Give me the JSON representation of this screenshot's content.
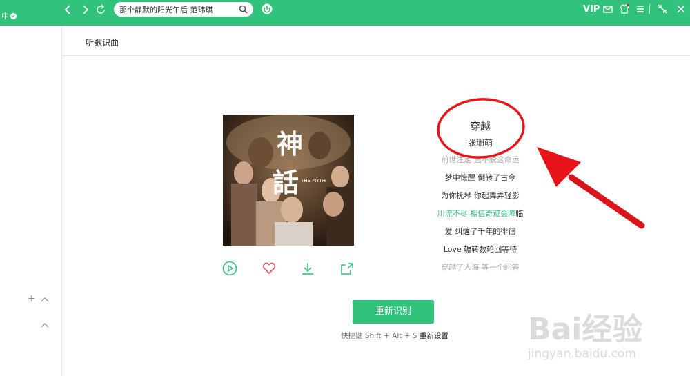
{
  "topbar": {
    "left_fragment": "中",
    "search": {
      "value": "那个静默的阳光午后 范玮琪",
      "placeholder": ""
    },
    "vip_label": "VIP"
  },
  "header": {
    "title": "听歌识曲"
  },
  "song": {
    "title": "穿越",
    "artist": "张珊萌",
    "lyrics": [
      {
        "text": "前世注定 逃不脱这命运",
        "state": "faded"
      },
      {
        "text": "梦中惊醒 倒转了古今",
        "state": "normal"
      },
      {
        "text": "为你抚琴 你起舞弄轻影",
        "state": "normal"
      },
      {
        "text": "川流不尽 相信奇迹会降",
        "tail": "临",
        "state": "active"
      },
      {
        "text": "爱 纠缠了千年的徘徊",
        "state": "normal"
      },
      {
        "text": "Love 辗转数轮回等待",
        "state": "normal"
      },
      {
        "text": "穿越了人海 等一个回答",
        "state": "faded"
      }
    ],
    "cover": {
      "title_glyphs": "神話",
      "subtitle": "THE MYTH"
    }
  },
  "actions": [
    "play-icon",
    "heart-icon",
    "download-icon",
    "share-icon"
  ],
  "recognize_button": "重新识别",
  "hint": {
    "prefix": "快捷键 Shift + Alt + S ",
    "setting": "重新设置"
  },
  "sidebar": {
    "plus": "+",
    "chevron": "^"
  },
  "watermark": {
    "brand": "Bai经验",
    "url": "jingyan.baidu.com"
  },
  "colors": {
    "accent": "#31c27c",
    "annotation": "#e8141b"
  }
}
